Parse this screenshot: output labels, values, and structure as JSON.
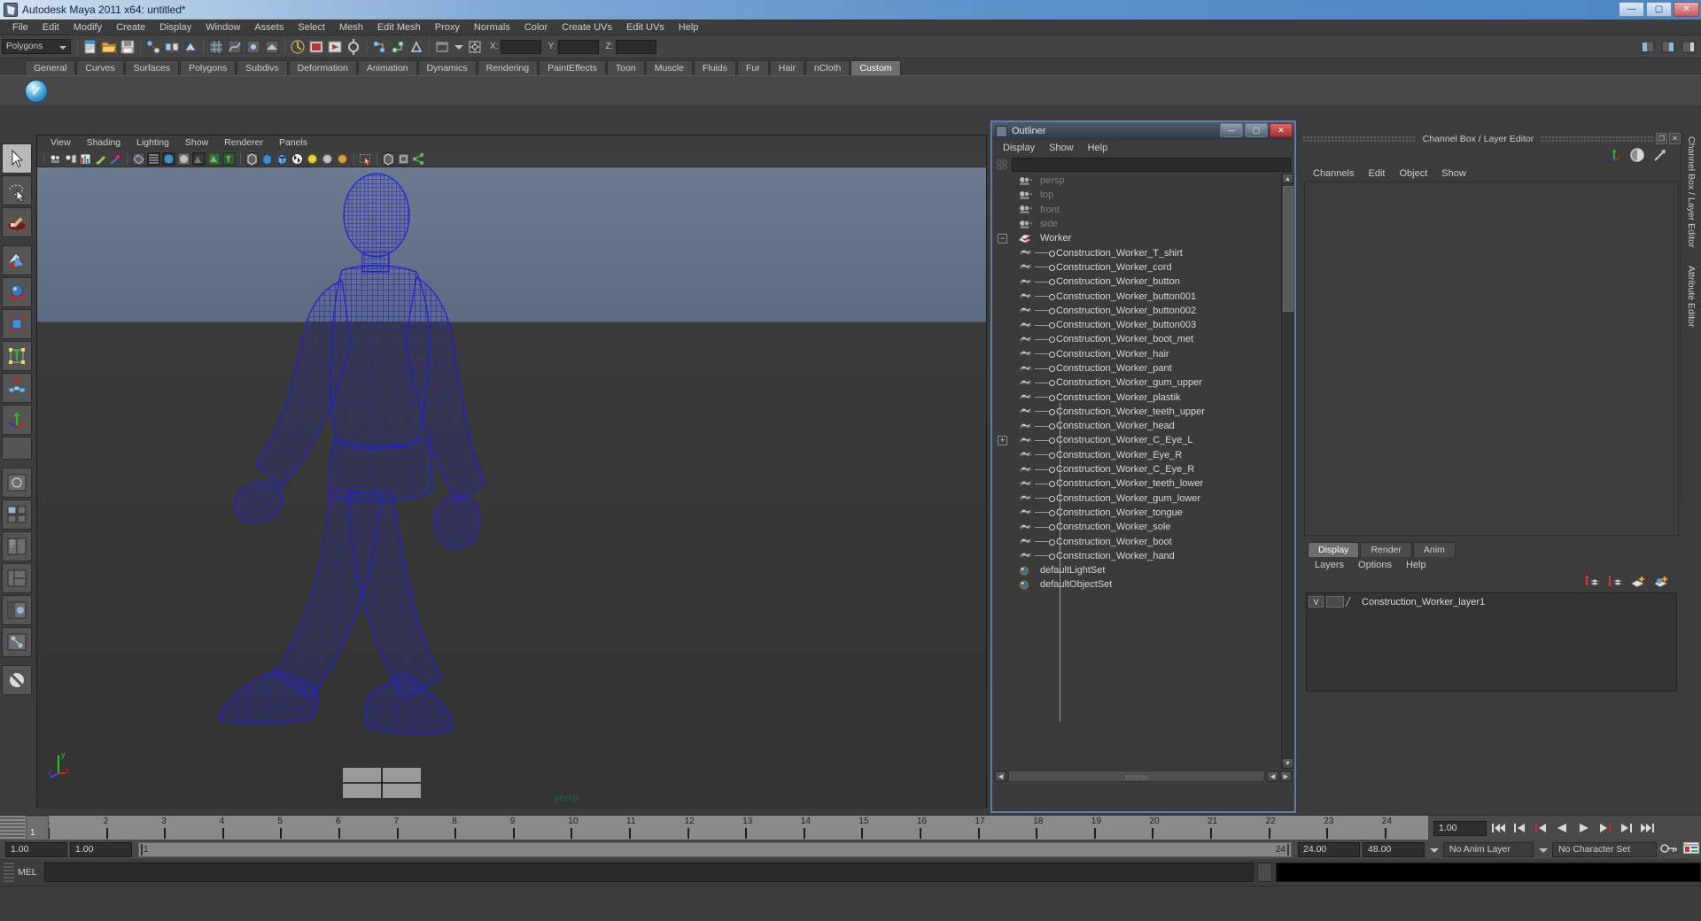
{
  "window": {
    "title": "Autodesk Maya 2011 x64: untitled*",
    "minimize": "—",
    "maximize": "▢",
    "close": "✕"
  },
  "menubar": {
    "items": [
      "File",
      "Edit",
      "Modify",
      "Create",
      "Display",
      "Window",
      "Assets",
      "Select",
      "Mesh",
      "Edit Mesh",
      "Proxy",
      "Normals",
      "Color",
      "Create UVs",
      "Edit UVs",
      "Help"
    ]
  },
  "statusbar": {
    "menuset": "Polygons",
    "x_label": "X:",
    "y_label": "Y:",
    "z_label": "Z:",
    "x_value": "",
    "y_value": "",
    "z_value": ""
  },
  "shelf": {
    "tabs": [
      "General",
      "Curves",
      "Surfaces",
      "Polygons",
      "Subdivs",
      "Deformation",
      "Animation",
      "Dynamics",
      "Rendering",
      "PaintEffects",
      "Toon",
      "Muscle",
      "Fluids",
      "Fur",
      "Hair",
      "nCloth",
      "Custom"
    ],
    "active_tab": "Custom",
    "buttons": [
      "check-shelf-button"
    ]
  },
  "toolbox": {
    "items": [
      {
        "name": "select-tool",
        "selected": true
      },
      {
        "name": "lasso-select-tool",
        "selected": false
      },
      {
        "name": "paint-select-tool",
        "selected": false
      },
      {
        "name": "move-tool",
        "selected": false
      },
      {
        "name": "rotate-tool",
        "selected": false
      },
      {
        "name": "scale-tool",
        "selected": false
      },
      {
        "name": "universal-manipulator-tool",
        "selected": false
      },
      {
        "name": "soft-modification-tool",
        "selected": false
      },
      {
        "name": "show-manipulator-tool",
        "selected": false
      },
      {
        "name": "last-tool-used",
        "selected": false
      }
    ],
    "layouts": [
      "single-perspective-layout",
      "four-view-layout",
      "two-pane-layout",
      "three-pane-layout",
      "outliner-persp-layout",
      "hypergraph-layout"
    ]
  },
  "viewport": {
    "menus": [
      "View",
      "Shading",
      "Lighting",
      "Show",
      "Renderer",
      "Panels"
    ],
    "camera_label": "persp",
    "axis": {
      "x": "x",
      "y": "y",
      "z": "z"
    },
    "icon_count": 22
  },
  "outliner": {
    "title": "Outliner",
    "minimize": "—",
    "maximize": "▢",
    "close": "✕",
    "menus": [
      "Display",
      "Show",
      "Help"
    ],
    "search_value": "",
    "search_placeholder": "",
    "items": [
      {
        "label": "persp",
        "indent": 0,
        "icon": "camera-icon",
        "dim": true,
        "expander": "",
        "child": false
      },
      {
        "label": "top",
        "indent": 0,
        "icon": "camera-icon",
        "dim": true,
        "expander": "",
        "child": false
      },
      {
        "label": "front",
        "indent": 0,
        "icon": "camera-icon",
        "dim": true,
        "expander": "",
        "child": false
      },
      {
        "label": "side",
        "indent": 0,
        "icon": "camera-icon",
        "dim": true,
        "expander": "",
        "child": false
      },
      {
        "label": "Worker",
        "indent": 0,
        "icon": "group-icon",
        "dim": false,
        "expander": "−",
        "child": false
      },
      {
        "label": "Construction_Worker_T_shirt",
        "indent": 1,
        "icon": "mesh-icon",
        "dim": false,
        "expander": "",
        "child": true
      },
      {
        "label": "Construction_Worker_cord",
        "indent": 1,
        "icon": "mesh-icon",
        "dim": false,
        "expander": "",
        "child": true
      },
      {
        "label": "Construction_Worker_button",
        "indent": 1,
        "icon": "mesh-icon",
        "dim": false,
        "expander": "",
        "child": true
      },
      {
        "label": "Construction_Worker_button001",
        "indent": 1,
        "icon": "mesh-icon",
        "dim": false,
        "expander": "",
        "child": true
      },
      {
        "label": "Construction_Worker_button002",
        "indent": 1,
        "icon": "mesh-icon",
        "dim": false,
        "expander": "",
        "child": true
      },
      {
        "label": "Construction_Worker_button003",
        "indent": 1,
        "icon": "mesh-icon",
        "dim": false,
        "expander": "",
        "child": true
      },
      {
        "label": "Construction_Worker_boot_met",
        "indent": 1,
        "icon": "mesh-icon",
        "dim": false,
        "expander": "",
        "child": true
      },
      {
        "label": "Construction_Worker_hair",
        "indent": 1,
        "icon": "mesh-icon",
        "dim": false,
        "expander": "",
        "child": true
      },
      {
        "label": "Construction_Worker_pant",
        "indent": 1,
        "icon": "mesh-icon",
        "dim": false,
        "expander": "",
        "child": true
      },
      {
        "label": "Construction_Worker_gum_upper",
        "indent": 1,
        "icon": "mesh-icon",
        "dim": false,
        "expander": "",
        "child": true
      },
      {
        "label": "Construction_Worker_plastik",
        "indent": 1,
        "icon": "mesh-icon",
        "dim": false,
        "expander": "",
        "child": true
      },
      {
        "label": "Construction_Worker_teeth_upper",
        "indent": 1,
        "icon": "mesh-icon",
        "dim": false,
        "expander": "",
        "child": true
      },
      {
        "label": "Construction_Worker_head",
        "indent": 1,
        "icon": "mesh-icon",
        "dim": false,
        "expander": "",
        "child": true
      },
      {
        "label": "Construction_Worker_C_Eye_L",
        "indent": 1,
        "icon": "mesh-icon",
        "dim": false,
        "expander": "+",
        "child": true
      },
      {
        "label": "Construction_Worker_Eye_R",
        "indent": 1,
        "icon": "mesh-icon",
        "dim": false,
        "expander": "",
        "child": true
      },
      {
        "label": "Construction_Worker_C_Eye_R",
        "indent": 1,
        "icon": "mesh-icon",
        "dim": false,
        "expander": "",
        "child": true
      },
      {
        "label": "Construction_Worker_teeth_lower",
        "indent": 1,
        "icon": "mesh-icon",
        "dim": false,
        "expander": "",
        "child": true
      },
      {
        "label": "Construction_Worker_gum_lower",
        "indent": 1,
        "icon": "mesh-icon",
        "dim": false,
        "expander": "",
        "child": true
      },
      {
        "label": "Construction_Worker_tongue",
        "indent": 1,
        "icon": "mesh-icon",
        "dim": false,
        "expander": "",
        "child": true
      },
      {
        "label": "Construction_Worker_sole",
        "indent": 1,
        "icon": "mesh-icon",
        "dim": false,
        "expander": "",
        "child": true
      },
      {
        "label": "Construction_Worker_boot",
        "indent": 1,
        "icon": "mesh-icon",
        "dim": false,
        "expander": "",
        "child": true
      },
      {
        "label": "Construction_Worker_hand",
        "indent": 1,
        "icon": "mesh-icon",
        "dim": false,
        "expander": "",
        "child": true
      },
      {
        "label": "defaultLightSet",
        "indent": 0,
        "icon": "set-icon",
        "dim": false,
        "expander": "",
        "child": false
      },
      {
        "label": "defaultObjectSet",
        "indent": 0,
        "icon": "set-icon",
        "dim": false,
        "expander": "",
        "child": false
      }
    ]
  },
  "channelbox": {
    "title": "Channel Box / Layer Editor",
    "restore": "❐",
    "close": "✕",
    "menus": [
      "Channels",
      "Edit",
      "Object",
      "Show"
    ],
    "icons": [
      "channel-box-icon",
      "attribute-editor-icon",
      "layer-editor-icon"
    ],
    "vertical_tabs": [
      "Channel Box / Layer Editor",
      "Attribute Editor"
    ]
  },
  "layereditor": {
    "tabs": [
      "Display",
      "Render",
      "Anim"
    ],
    "active_tab": "Display",
    "menus": [
      "Layers",
      "Options",
      "Help"
    ],
    "toolbar_icons": [
      "move-layer-up-icon",
      "move-layer-down-icon",
      "new-layer-icon",
      "new-layer-from-selected-icon"
    ],
    "layers": [
      {
        "visibility": "V",
        "playback": "",
        "name": "Construction_Worker_layer1"
      }
    ]
  },
  "timeline": {
    "frames": [
      "1",
      "2",
      "3",
      "4",
      "5",
      "6",
      "7",
      "8",
      "9",
      "10",
      "11",
      "12",
      "13",
      "14",
      "15",
      "16",
      "17",
      "18",
      "19",
      "20",
      "21",
      "22",
      "23",
      "24"
    ],
    "current_frame": "1",
    "current_time_value": "1.00",
    "playback_buttons": [
      "go-to-start",
      "step-back-key",
      "step-back-frame",
      "play-backwards",
      "play-forwards",
      "step-forward-frame",
      "step-forward-key",
      "go-to-end"
    ]
  },
  "rangeslider": {
    "start_field": "1.00",
    "end_field": "1.00",
    "range_start_label": "1",
    "range_end_label": "24",
    "playback_start": "24.00",
    "playback_end": "48.00",
    "anim_layer": "No Anim Layer",
    "character_set": "No Character Set"
  },
  "commandline": {
    "language_label": "MEL",
    "input_value": "",
    "input_placeholder": "",
    "output_value": ""
  },
  "colors": {
    "window_bg": "#3c3c3c",
    "panel_bg": "#444444",
    "viewport_top": "#6c7b90",
    "viewport_bottom": "#333333",
    "mesh_wireframe": "#1a1ad0",
    "title_gradient_start": "#d4e3f2",
    "title_gradient_end": "#4d86c6",
    "outliner_border": "#5a7fa8",
    "persp_label": "#1f6b30",
    "timeline_bg": "#8a8a8a",
    "close_button": "#c45a5c"
  }
}
